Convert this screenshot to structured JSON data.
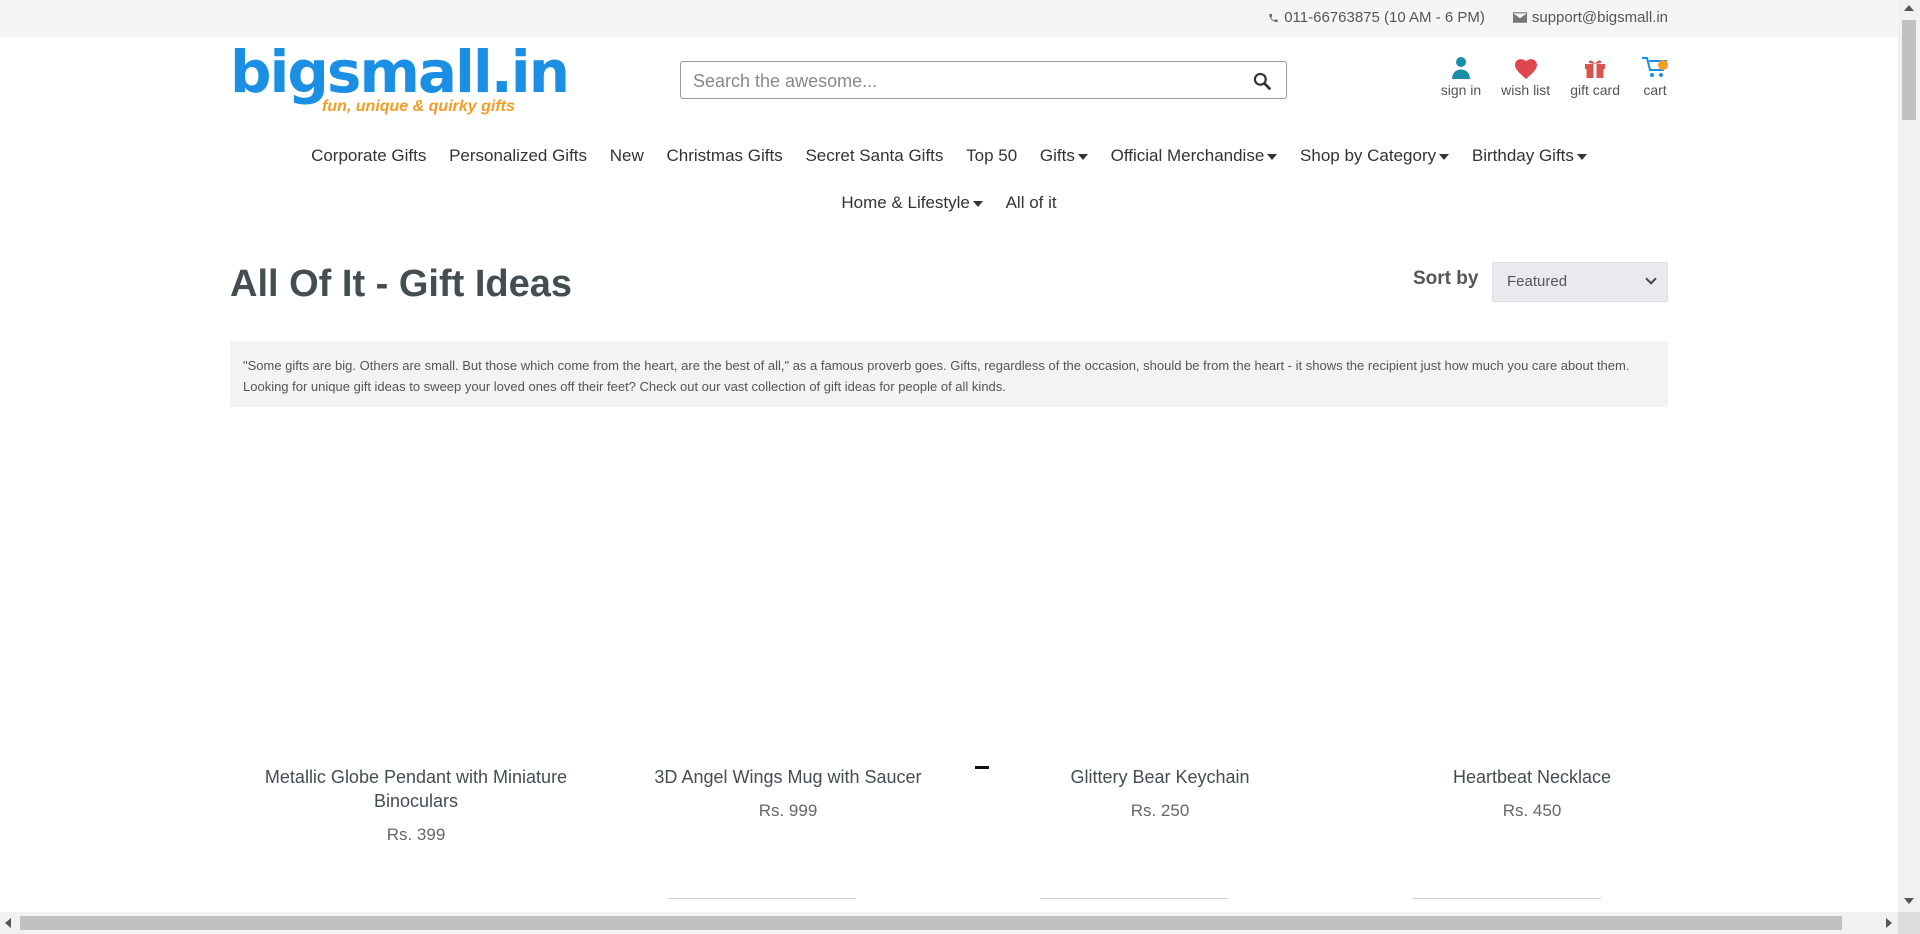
{
  "topbar": {
    "phone": "011-66763875 (10 AM - 6 PM)",
    "email": "support@bigsmall.in"
  },
  "logo": {
    "word": "bigsmall.in",
    "tagline": "fun, unique & quirky gifts"
  },
  "search": {
    "placeholder": "Search the awesome..."
  },
  "header_links": {
    "sign_in": "sign in",
    "wish_list": "wish list",
    "gift_card": "gift card",
    "cart": "cart"
  },
  "nav": {
    "corporate": "Corporate Gifts",
    "personalized": "Personalized Gifts",
    "new": "New",
    "christmas": "Christmas Gifts",
    "secret_santa": "Secret Santa Gifts",
    "top50": "Top 50",
    "gifts": "Gifts",
    "official": "Official Merchandise",
    "shop_by_category": "Shop by Category",
    "birthday": "Birthday Gifts",
    "home_lifestyle": "Home & Lifestyle",
    "all_of_it": "All of it"
  },
  "page": {
    "title": "All Of It - Gift Ideas",
    "sort_label": "Sort by",
    "sort_value": "Featured",
    "description": "\"Some gifts are big. Others are small. But those which come from the heart, are the best of all,\" as a famous proverb goes. Gifts, regardless of the occasion, should be from the heart - it shows the recipient just how much you care about them. Looking for unique gift ideas to sweep your loved ones off their feet? Check out our vast collection of gift ideas for people of all kinds."
  },
  "products": [
    {
      "name": "Metallic Globe Pendant with Miniature Binoculars",
      "price": "Rs. 399"
    },
    {
      "name": "3D Angel Wings Mug with Saucer",
      "price": "Rs. 999"
    },
    {
      "name": "Glittery Bear Keychain",
      "price": "Rs. 250"
    },
    {
      "name": "Heartbeat Necklace",
      "price": "Rs. 450"
    }
  ],
  "colors": {
    "brand_blue": "#1a8fe3",
    "brand_orange": "#f39c26",
    "wish_red": "#e0474c",
    "user_teal": "#1a8fa8"
  }
}
